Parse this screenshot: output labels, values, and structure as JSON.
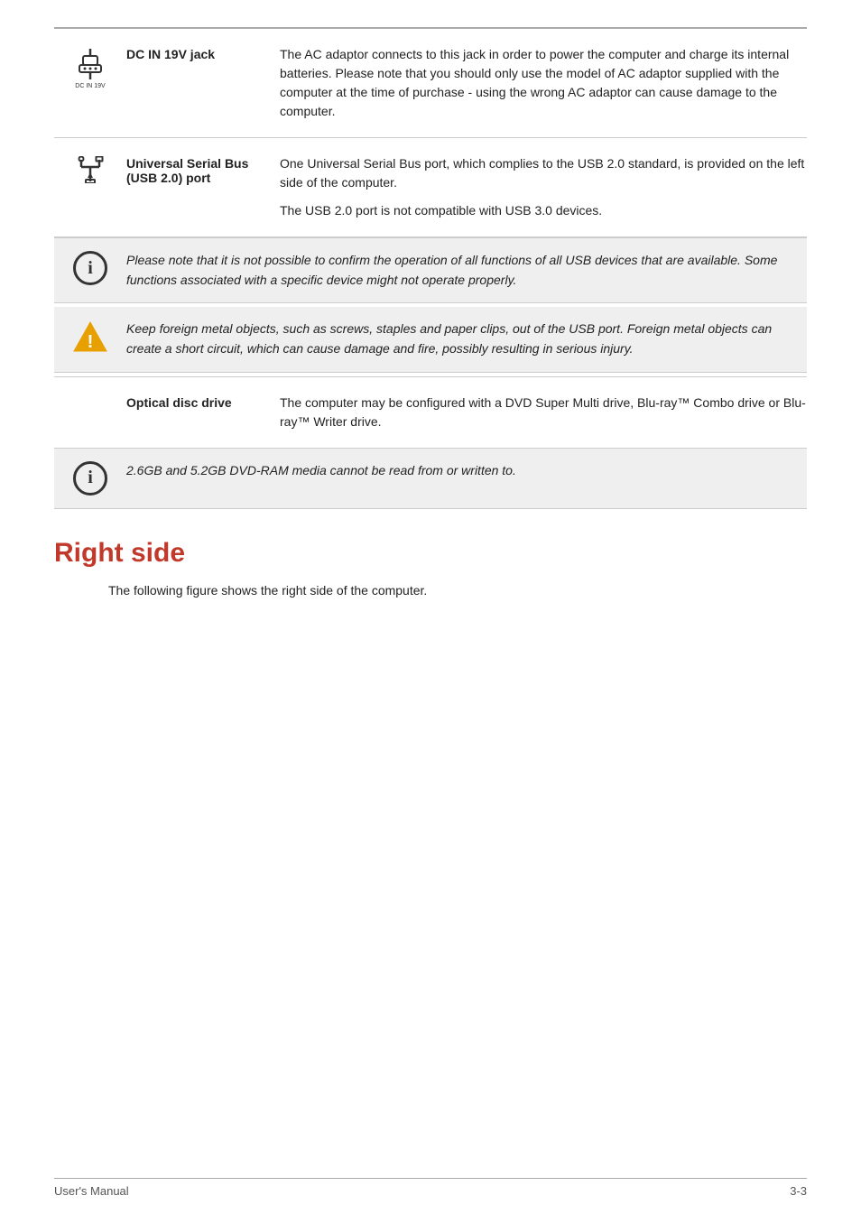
{
  "page": {
    "top_rule": true,
    "entries": [
      {
        "id": "dc-in",
        "icon": "dc-jack-icon",
        "label": "DC IN 19V jack",
        "description": [
          "The AC adaptor connects to this jack in order to power the computer and charge its internal batteries. Please note that you should only use the model of AC adaptor supplied with the computer at the time of purchase - using the wrong AC adaptor can cause damage to the computer."
        ]
      },
      {
        "id": "usb",
        "icon": "usb-icon",
        "label": "Universal Serial Bus (USB 2.0) port",
        "description": [
          "One Universal Serial Bus port, which complies to the USB 2.0 standard, is provided on the left side of the computer.",
          "The USB 2.0 port is not compatible with USB 3.0 devices."
        ]
      }
    ],
    "note1": {
      "icon": "info-icon",
      "text": "Please note that it is not possible to confirm the operation of all functions of all USB devices that are available. Some functions associated with a specific device might not operate properly."
    },
    "warning1": {
      "icon": "warning-icon",
      "text": "Keep foreign metal objects, such as screws, staples and paper clips, out of the USB port. Foreign metal objects can create a short circuit, which can cause damage and fire, possibly resulting in serious injury."
    },
    "entry_optical": {
      "id": "optical",
      "label": "Optical disc drive",
      "description": [
        "The computer may be configured with a DVD Super Multi drive, Blu-ray™ Combo drive or Blu-ray™ Writer drive."
      ]
    },
    "note2": {
      "icon": "info-icon",
      "text": "2.6GB and 5.2GB DVD-RAM media cannot be read from or written to."
    },
    "section": {
      "heading": "Right side",
      "intro": "The following figure shows the right side of the computer."
    },
    "footer": {
      "left": "User's Manual",
      "right": "3-3"
    }
  }
}
